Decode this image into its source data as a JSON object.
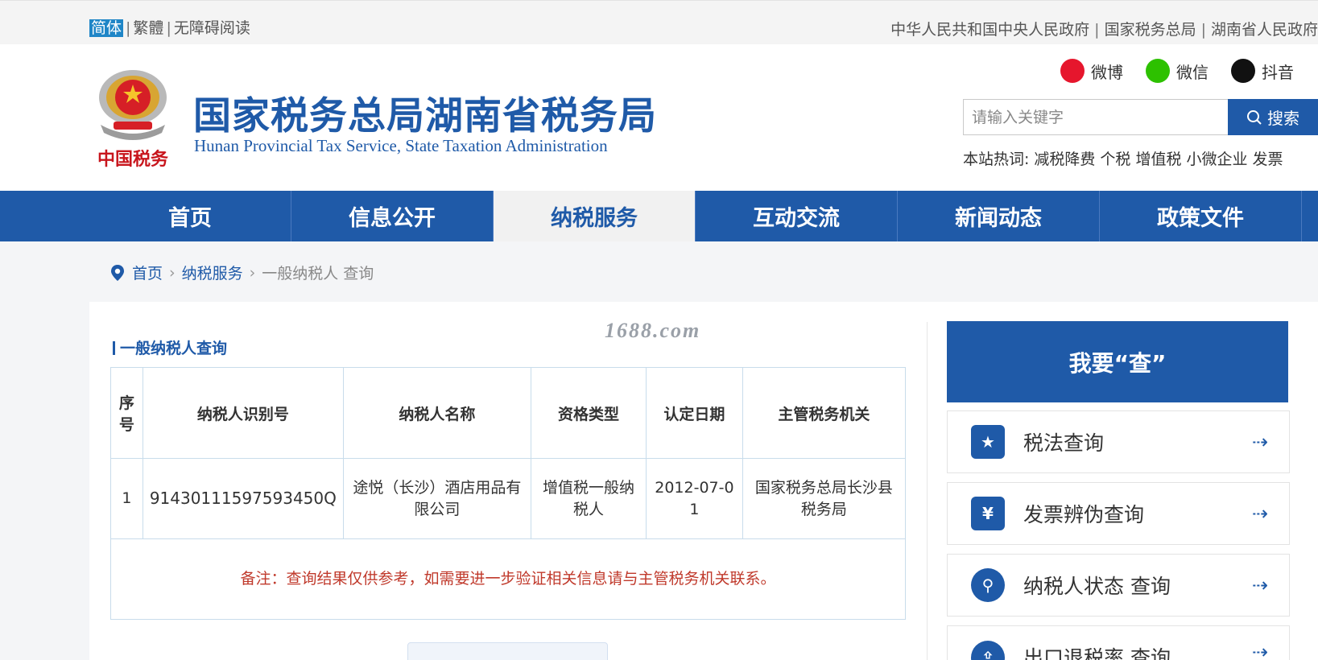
{
  "topbar": {
    "lang_simplified": "简体",
    "lang_traditional": "繁體",
    "accessibility": "无障碍阅读",
    "links": [
      "中华人民共和国中央人民政府",
      "国家税务总局",
      "湖南省人民政府"
    ]
  },
  "header": {
    "title_cn": "国家税务总局湖南省税务局",
    "title_en": "Hunan Provincial  Tax Service,  State Taxation Administration",
    "emblem_text": "中国税务",
    "social": [
      {
        "label": "微博",
        "icon": "weibo-icon"
      },
      {
        "label": "微信",
        "icon": "wechat-icon"
      },
      {
        "label": "抖音",
        "icon": "douyin-icon"
      }
    ],
    "search": {
      "placeholder": "请输入关键字",
      "button_label": "搜索"
    },
    "hot_words": {
      "label": "本站热词:",
      "items": [
        "减税降费",
        "个税",
        "增值税",
        "小微企业",
        "发票"
      ]
    }
  },
  "nav": {
    "items": [
      "首页",
      "信息公开",
      "纳税服务",
      "互动交流",
      "新闻动态",
      "政策文件"
    ],
    "active": "纳税服务"
  },
  "breadcrumb": {
    "home": "首页",
    "level1": "纳税服务",
    "current": "一般纳税人 查询"
  },
  "section_title": "一般纳税人查询",
  "watermark": "1688.com",
  "table": {
    "headers": [
      "序号",
      "纳税人识别号",
      "纳税人名称",
      "资格类型",
      "认定日期",
      "主管税务机关"
    ],
    "rows": [
      {
        "index": "1",
        "tax_id": "91430111597593450Q",
        "name": "途悦（长沙）酒店用品有限公司",
        "qualification": "增值税一般纳税人",
        "date": "2012-07-01",
        "authority": "国家税务总局长沙县税务局"
      }
    ],
    "note": "备注：查询结果仅供参考，如需要进一步验证相关信息请与主管税务机关联系。"
  },
  "right_panel": {
    "title": "我要“查”",
    "items": [
      {
        "label": "税法查询",
        "icon": "book-star-icon"
      },
      {
        "label": "发票辨伪查询",
        "icon": "invoice-yen-icon"
      },
      {
        "label": "纳税人状态 查询",
        "icon": "user-search-icon"
      },
      {
        "label": "出口退税率 查询",
        "icon": "export-icon"
      }
    ]
  },
  "colors": {
    "brand_blue": "#1f5aa8",
    "note_red": "#c0392b",
    "nav_active_bg": "#f1f1f1"
  }
}
